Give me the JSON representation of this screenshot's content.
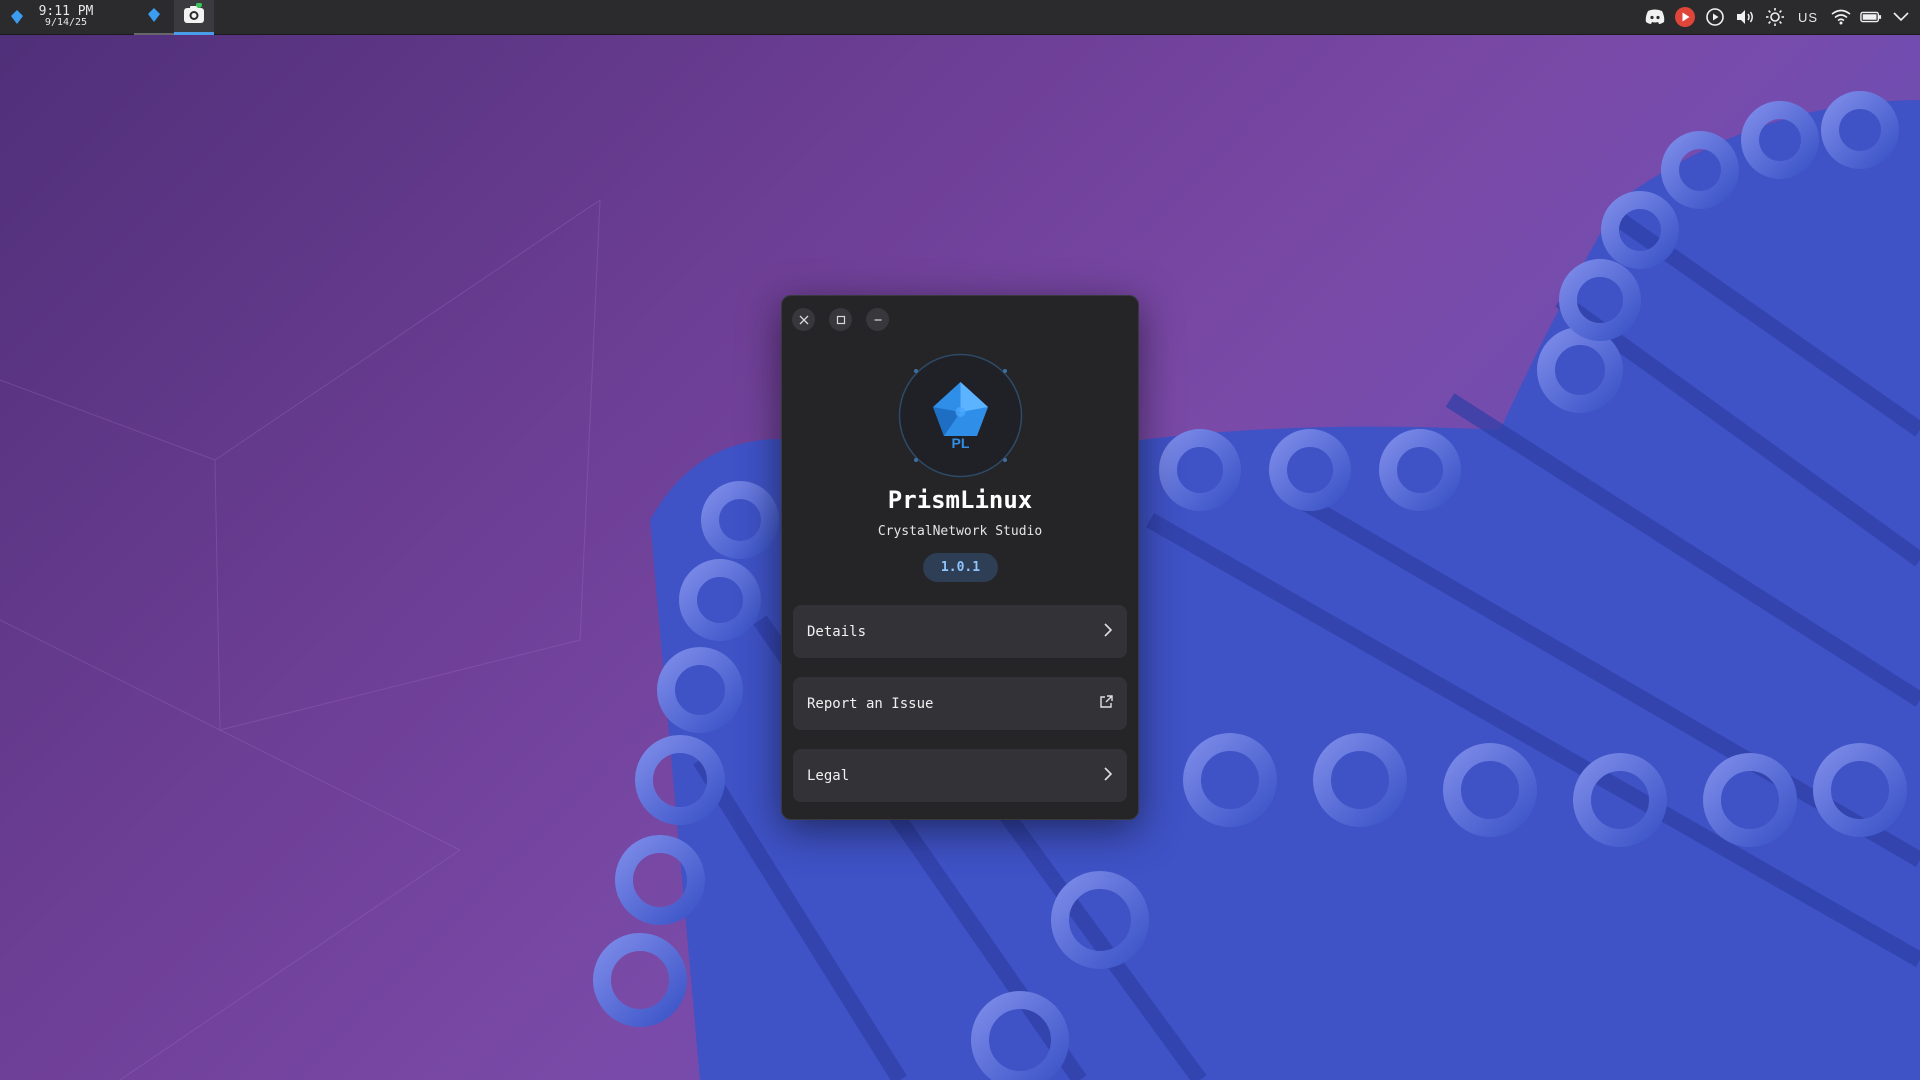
{
  "panel": {
    "launcher_icon": "prism-launcher-icon",
    "clock": {
      "time": "9:11 PM",
      "date": "9/14/25"
    },
    "tasks": [
      {
        "name": "prism-app-task",
        "icon": "prism-icon"
      },
      {
        "name": "screenshot-task",
        "icon": "camera-icon"
      }
    ],
    "tray": {
      "discord_icon": "discord-icon",
      "recorder_icon": "record-icon",
      "media_icon": "play-icon",
      "volume_icon": "volume-icon",
      "brightness_icon": "brightness-icon",
      "keyboard_layout": "US",
      "wifi_icon": "wifi-icon",
      "battery_icon": "battery-icon",
      "expand_icon": "chevron-down-icon"
    }
  },
  "about": {
    "logo_text": "PL",
    "app_name": "PrismLinux",
    "developer": "CrystalNetwork Studio",
    "version": "1.0.1",
    "rows": [
      {
        "label": "Details",
        "icon": "chevron-right-icon"
      },
      {
        "label": "Report an Issue",
        "icon": "external-link-icon"
      },
      {
        "label": "Legal",
        "icon": "chevron-right-icon"
      }
    ]
  },
  "colors": {
    "accent": "#4b9ce8",
    "window_bg": "#252528",
    "row_bg": "#333337",
    "version_text": "#8ec5ff",
    "record_red": "#e0453a"
  }
}
